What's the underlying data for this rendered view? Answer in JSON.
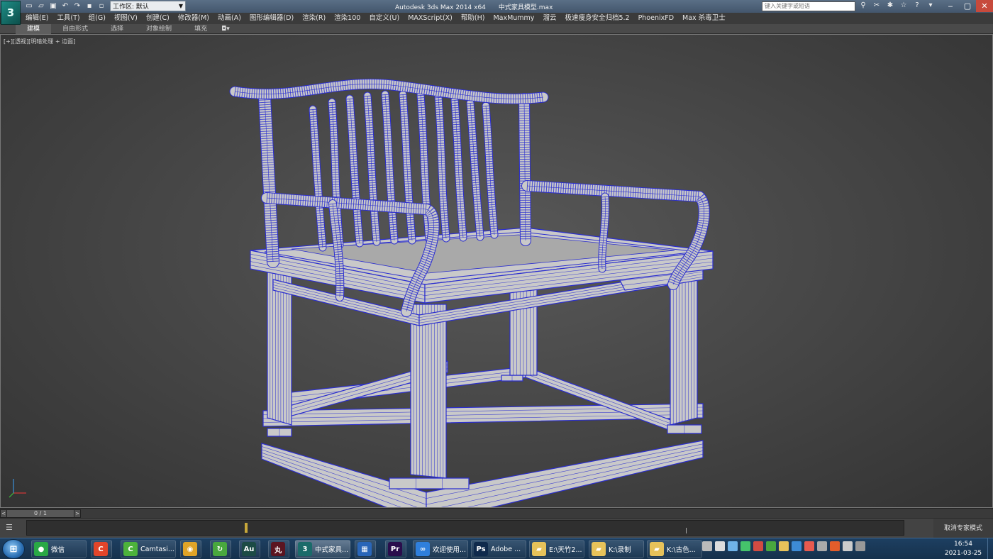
{
  "titlebar": {
    "app_logo": "3",
    "workspace_label": "工作区: 默认",
    "app_name": "Autodesk 3ds Max  2014 x64",
    "file_name": "中式家具模型.max",
    "search_placeholder": "键入关键字或短语",
    "icons": [
      "binoculars-icon",
      "tools-icon",
      "info-star-icon",
      "star-icon",
      "help-icon"
    ]
  },
  "menu": {
    "items": [
      "编辑(E)",
      "工具(T)",
      "组(G)",
      "视图(V)",
      "创建(C)",
      "修改器(M)",
      "动画(A)",
      "图形编辑器(D)",
      "渲染(R)",
      "渲染100",
      "自定义(U)",
      "MAXScript(X)",
      "帮助(H)",
      "MaxMummy",
      "溜云",
      "极速瘦身安全归档5.2",
      "PhoenixFD",
      "Max 杀毒卫士"
    ]
  },
  "ribbon": {
    "tabs": [
      "建模",
      "自由形式",
      "选择",
      "对象绘制",
      "填充"
    ],
    "active": 0,
    "extra": "◘▾"
  },
  "viewport": {
    "label": "[+][透视][明暗处理 + 边面]",
    "wire_color": "#2b2ecf",
    "mesh_color": "#c9c9c9"
  },
  "timeline": {
    "frame": "0 / 1",
    "prev": "<",
    "next": ">"
  },
  "trackbar": {
    "icon": "☰",
    "expert_mode": "取消专家模式"
  },
  "taskbar": {
    "start": "⊞",
    "items": [
      {
        "label": "微信",
        "icon": "wechat-icon",
        "color": "#2aa845",
        "glyph": "●"
      },
      {
        "label": "",
        "icon": "camtasia-recorder-icon",
        "color": "#e2452a",
        "glyph": "C"
      },
      {
        "label": "Camtasi...",
        "icon": "camtasia-icon",
        "color": "#4db23b",
        "glyph": "C"
      },
      {
        "label": "",
        "icon": "chrome-icon",
        "color": "#e0a428",
        "glyph": "◉"
      },
      {
        "label": "",
        "icon": "refresh-icon",
        "color": "#49a83e",
        "glyph": "↻"
      },
      {
        "label": "",
        "icon": "audition-icon",
        "color": "#1c4b45",
        "glyph": "Au"
      },
      {
        "label": "",
        "icon": "wan-icon",
        "color": "#5b1521",
        "glyph": "丸"
      },
      {
        "label": "中式家具...",
        "icon": "3dsmax-icon",
        "color": "#1b6b6a",
        "glyph": "3"
      },
      {
        "label": "",
        "icon": "grid-app-icon",
        "color": "#2a66b8",
        "glyph": "▦"
      },
      {
        "label": "",
        "icon": "premiere-icon",
        "color": "#2a0d4c",
        "glyph": "Pr"
      },
      {
        "label": "欢迎使用...",
        "icon": "baidu-netdisk-icon",
        "color": "#2f7fdc",
        "glyph": "∞"
      },
      {
        "label": "Adobe ...",
        "icon": "photoshop-icon",
        "color": "#0f2a4c",
        "glyph": "Ps"
      },
      {
        "label": "E:\\天竹2...",
        "icon": "folder-icon",
        "color": "#e7c25a",
        "glyph": "▰"
      },
      {
        "label": "K:\\录制",
        "icon": "folder-icon",
        "color": "#e7c25a",
        "glyph": "▰"
      },
      {
        "label": "K:\\古色...",
        "icon": "folder-icon",
        "color": "#e7c25a",
        "glyph": "▰"
      }
    ],
    "clock_time": "16:54",
    "clock_date": "2021-03-25"
  }
}
